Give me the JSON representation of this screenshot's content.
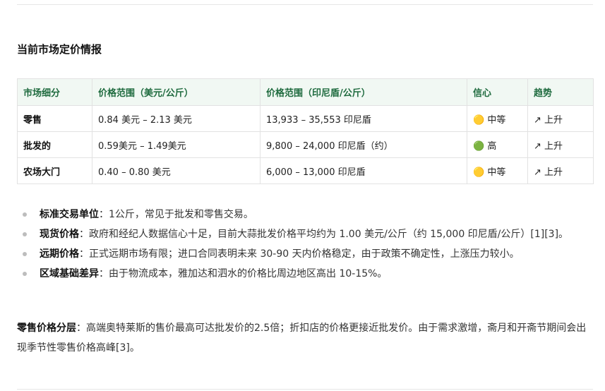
{
  "title": "当前市场定价情报",
  "table": {
    "headers": [
      "市场细分",
      "价格范围（美元/公斤）",
      "价格范围（印尼盾/公斤）",
      "信心",
      "趋势"
    ],
    "rows": [
      [
        "零售",
        "0.84 美元 – 2.13 美元",
        "13,933 – 35,553 印尼盾",
        "🟡 中等",
        "↗ 上升"
      ],
      [
        "批发的",
        "0.59美元 – 1.49美元",
        "9,800 – 24,000 印尼盾（约）",
        "🟢 高",
        "↗ 上升"
      ],
      [
        "农场大门",
        "0.40 – 0.80 美元",
        "6,000 – 13,000 印尼盾",
        "🟡 中等",
        "↗ 上升"
      ]
    ]
  },
  "bullets": [
    {
      "label": "标准交易单位",
      "text": "：1公斤，常见于批发和零售交易。"
    },
    {
      "label": "现货价格",
      "text": "：政府和经纪人数据信心十足，目前大蒜批发价格平均约为 1.00 美元/公斤（约 15,000 印尼盾/公斤）[1][3]。"
    },
    {
      "label": "远期价格",
      "text": "：正式远期市场有限；进口合同表明未来 30-90 天内价格稳定，由于政策不确定性，上涨压力较小。"
    },
    {
      "label": "区域基础差异",
      "text": "：由于物流成本，雅加达和泗水的价格比周边地区高出 10-15%。"
    }
  ],
  "paragraph": {
    "label": "零售价格分层",
    "text": "：高端奥特莱斯的售价最高可达批发价的2.5倍；折扣店的价格更接近批发价。由于需求激增，斋月和开斋节期间会出现季节性零售价格高峰[3]。"
  }
}
